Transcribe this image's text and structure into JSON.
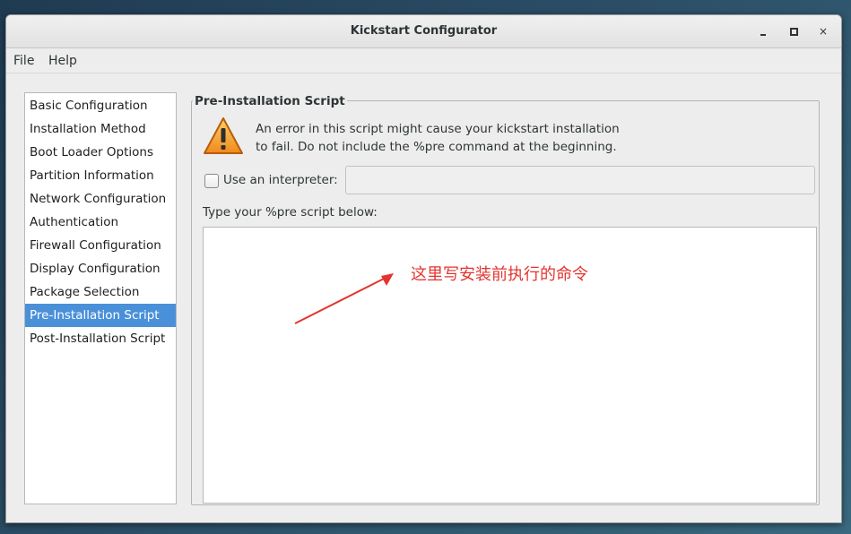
{
  "window": {
    "title": "Kickstart Configurator",
    "controls": {
      "minimize": "minimize",
      "maximize": "maximize",
      "close": "×"
    }
  },
  "menu": {
    "items": [
      {
        "label": "File"
      },
      {
        "label": "Help"
      }
    ]
  },
  "sidebar": {
    "selected_index": 9,
    "items": [
      {
        "label": "Basic Configuration"
      },
      {
        "label": "Installation Method"
      },
      {
        "label": "Boot Loader Options"
      },
      {
        "label": "Partition Information"
      },
      {
        "label": "Network Configuration"
      },
      {
        "label": "Authentication"
      },
      {
        "label": "Firewall Configuration"
      },
      {
        "label": "Display Configuration"
      },
      {
        "label": "Package Selection"
      },
      {
        "label": "Pre-Installation Script"
      },
      {
        "label": "Post-Installation Script"
      }
    ]
  },
  "panel": {
    "title": "Pre-Installation Script",
    "warning_icon": "warning-triangle-icon",
    "warning_line1": "An error in this script might cause your kickstart installation",
    "warning_line2": "to fail. Do not include the %pre command at the beginning.",
    "interpreter": {
      "checked": false,
      "label": "Use an interpreter:",
      "value": "",
      "placeholder": ""
    },
    "script_prompt": "Type your %pre script below:",
    "script_value": ""
  },
  "annotation": {
    "text": "这里写安装前执行的命令",
    "color": "#e3342f"
  },
  "colors": {
    "selection": "#4a90d9",
    "window_bg": "#ededed"
  }
}
